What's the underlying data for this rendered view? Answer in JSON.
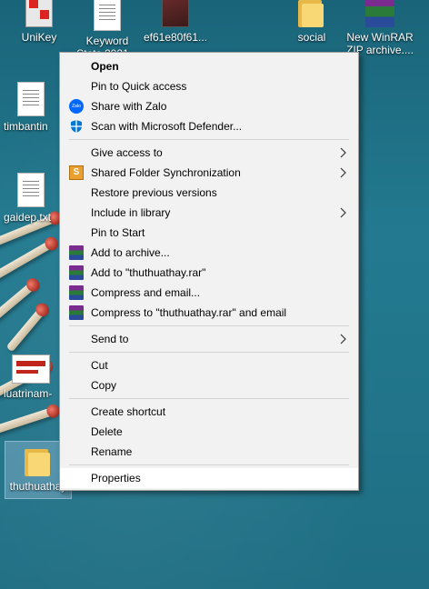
{
  "desktop": {
    "icons": [
      {
        "label": "UniKey"
      },
      {
        "label": "Keyword Stats 2021..."
      },
      {
        "label": "ef61e80f61..."
      },
      {
        "label": "social"
      },
      {
        "label": "New WinRAR ZIP archive...."
      },
      {
        "label": "timbantin"
      },
      {
        "label": "gaidep.txt"
      },
      {
        "label": "luatrinam-"
      },
      {
        "label": "thuthuathay"
      }
    ]
  },
  "menu": {
    "items": [
      {
        "label": "Open"
      },
      {
        "label": "Pin to Quick access"
      },
      {
        "label": "Share with Zalo"
      },
      {
        "label": "Scan with Microsoft Defender..."
      },
      {
        "label": "Give access to"
      },
      {
        "label": "Shared Folder Synchronization"
      },
      {
        "label": "Restore previous versions"
      },
      {
        "label": "Include in library"
      },
      {
        "label": "Pin to Start"
      },
      {
        "label": "Add to archive..."
      },
      {
        "label": "Add to \"thuthuathay.rar\""
      },
      {
        "label": "Compress and email..."
      },
      {
        "label": "Compress to \"thuthuathay.rar\" and email"
      },
      {
        "label": "Send to"
      },
      {
        "label": "Cut"
      },
      {
        "label": "Copy"
      },
      {
        "label": "Create shortcut"
      },
      {
        "label": "Delete"
      },
      {
        "label": "Rename"
      },
      {
        "label": "Properties"
      }
    ]
  },
  "colors": {
    "desktop_bg": "#1f6f85",
    "menu_bg": "#f2f2f2",
    "defender_blue": "#0078d4",
    "zalo_blue": "#0068ff",
    "winrar": "#7b2a8f"
  },
  "icons": {
    "zalo": "zalo-icon",
    "defender": "shield-icon",
    "sync": "sync-icon",
    "winrar": "winrar-icon",
    "arrow": "chevron-right-icon"
  }
}
